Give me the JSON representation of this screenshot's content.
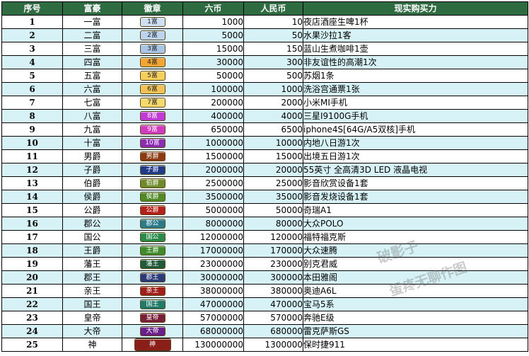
{
  "header": {
    "no": "序号",
    "title": "富豪",
    "badge": "徽章",
    "coin": "六币",
    "rmb": "人民币",
    "buy": "现实购买力"
  },
  "rows": [
    {
      "no": "1",
      "title": "一富",
      "badge": "1富",
      "color": "#cfe0f4",
      "coin": "1000",
      "rmb": "10",
      "buy": "夜店酒座生啤1杯"
    },
    {
      "no": "2",
      "title": "二富",
      "badge": "2富",
      "color": "#bcd3ee",
      "coin": "5000",
      "rmb": "50",
      "buy": "水果沙拉1客"
    },
    {
      "no": "3",
      "title": "三富",
      "badge": "3富",
      "color": "#a9c6e6",
      "coin": "15000",
      "rmb": "150",
      "buy": "蓝山生煮咖啡1壶"
    },
    {
      "no": "4",
      "title": "四富",
      "badge": "4富",
      "color": "#f3a533",
      "coin": "30000",
      "rmb": "300",
      "buy": "非友谊性的高潮1次"
    },
    {
      "no": "5",
      "title": "五富",
      "badge": "5富",
      "color": "#f5cf5e",
      "coin": "50000",
      "rmb": "500",
      "buy": "苏烟1条"
    },
    {
      "no": "6",
      "title": "六富",
      "badge": "6富",
      "color": "#f1c256",
      "coin": "100000",
      "rmb": "1000",
      "buy": "洗浴宫通票1张"
    },
    {
      "no": "7",
      "title": "七富",
      "badge": "7富",
      "color": "#f6d96b",
      "coin": "200000",
      "rmb": "2000",
      "buy": "小米MI手机"
    },
    {
      "no": "8",
      "title": "八富",
      "badge": "8富",
      "color": "#c03ad4",
      "coin": "400000",
      "rmb": "4000",
      "buy": "三星I9100G手机"
    },
    {
      "no": "9",
      "title": "九富",
      "badge": "9富",
      "color": "#d13bbf",
      "coin": "650000",
      "rmb": "6500",
      "buy": "iphone4S[64G/A5双核]手机"
    },
    {
      "no": "10",
      "title": "十富",
      "badge": "10富",
      "color": "#8e2bb3",
      "coin": "1000000",
      "rmb": "10000",
      "buy": "内地八日游1次"
    },
    {
      "no": "11",
      "title": "男爵",
      "badge": "男爵",
      "color": "#8b3a12",
      "coin": "1500000",
      "rmb": "15000",
      "buy": "出境五日游1次"
    },
    {
      "no": "12",
      "title": "子爵",
      "badge": "子爵",
      "color": "#223a8a",
      "coin": "2000000",
      "rmb": "20000",
      "buy": "55英寸 全高清3D LED 液晶电视"
    },
    {
      "no": "13",
      "title": "伯爵",
      "badge": "伯爵",
      "color": "#6e8a2a",
      "coin": "2500000",
      "rmb": "25000",
      "buy": "影音欣赏设备1套"
    },
    {
      "no": "14",
      "title": "侯爵",
      "badge": "侯爵",
      "color": "#4f8a26",
      "coin": "3500000",
      "rmb": "35000",
      "buy": "影音发烧设备1套"
    },
    {
      "no": "15",
      "title": "公爵",
      "badge": "公爵",
      "color": "#b3221a",
      "coin": "5000000",
      "rmb": "50000",
      "buy": "奇瑞A1"
    },
    {
      "no": "16",
      "title": "郡公",
      "badge": "郡公",
      "color": "#2a7a8a",
      "coin": "8000000",
      "rmb": "80000",
      "buy": "大众POLO"
    },
    {
      "no": "17",
      "title": "国公",
      "badge": "国公",
      "color": "#2a8a4a",
      "coin": "12000000",
      "rmb": "120000",
      "buy": "福特福克斯"
    },
    {
      "no": "18",
      "title": "王爵",
      "badge": "王爵",
      "color": "#3f8a2a",
      "coin": "17000000",
      "rmb": "170000",
      "buy": "大众速腾"
    },
    {
      "no": "19",
      "title": "藩王",
      "badge": "藩王",
      "color": "#1f5a3a",
      "coin": "23000000",
      "rmb": "230000",
      "buy": "别克君威"
    },
    {
      "no": "20",
      "title": "郡王",
      "badge": "郡王",
      "color": "#2a3a7a",
      "coin": "30000000",
      "rmb": "300000",
      "buy": "本田雅阁"
    },
    {
      "no": "21",
      "title": "亲王",
      "badge": "亲王",
      "color": "#a01f1a",
      "coin": "38000000",
      "rmb": "380000",
      "buy": "奥迪A6L"
    },
    {
      "no": "22",
      "title": "国王",
      "badge": "国王",
      "color": "#1f7a6a",
      "coin": "47000000",
      "rmb": "470000",
      "buy": "宝马5系"
    },
    {
      "no": "23",
      "title": "皇帝",
      "badge": "皇帝",
      "color": "#7a1f3a",
      "coin": "57000000",
      "rmb": "570000",
      "buy": "奔驰E级"
    },
    {
      "no": "24",
      "title": "大帝",
      "badge": "大帝",
      "color": "#6a1f8a",
      "coin": "68000000",
      "rmb": "680000",
      "buy": "雷克萨斯GS"
    },
    {
      "no": "25",
      "title": "神",
      "badge": "神",
      "color": "#8a1f1a",
      "coin": "130000000",
      "rmb": "1300000",
      "buy": "保时捷911"
    }
  ],
  "watermark": {
    "line1": "破影子",
    "line2": "蛋疼无聊作图"
  }
}
